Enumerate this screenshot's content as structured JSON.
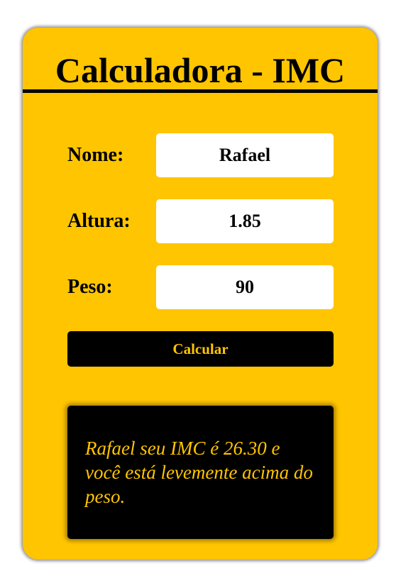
{
  "app": {
    "title": "Calculadora - IMC"
  },
  "form": {
    "name_label": "Nome:",
    "name_value": "Rafael",
    "height_label": "Altura:",
    "height_value": "1.85",
    "weight_label": "Peso:",
    "weight_value": "90",
    "calculate_label": "Calcular"
  },
  "result": {
    "text": "Rafael seu IMC é 26.30 e você está levemente acima do peso."
  },
  "colors": {
    "background": "#FFC500",
    "text": "#000000",
    "button_text": "#FFC500",
    "input_background": "#FFFFFF"
  }
}
